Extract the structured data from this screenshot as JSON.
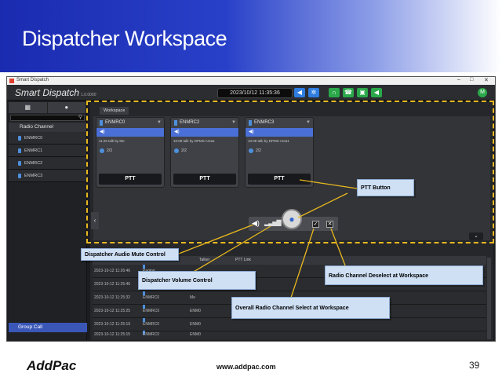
{
  "slide": {
    "title": "Dispatcher Workspace",
    "footer_logo": "AddPac",
    "footer_url": "www.addpac.com",
    "page_number": "39"
  },
  "window": {
    "title": "Smart Dispatch",
    "min": "–",
    "max": "□",
    "close": "✕"
  },
  "app": {
    "brand": "Smart Dispatch",
    "version": "1.0.0000",
    "clock": "2023/10/12 11:35:36",
    "avatar": "M"
  },
  "sidebar": {
    "section": "Radio Channel",
    "channels": [
      "ENMRC0",
      "ENMRC1",
      "ENMRC2",
      "ENMRC3"
    ],
    "group_call": "Group Call"
  },
  "workspace": {
    "tab": "Workspace",
    "cards": [
      {
        "name": "ENMRC0",
        "message": "11:25 talk by Me",
        "count": "2/3",
        "ptt": "PTT"
      },
      {
        "name": "ENMRC2",
        "message": "10:08 talk by DPMS Area1",
        "count": "2/2",
        "ptt": "PTT"
      },
      {
        "name": "ENMRC3",
        "message": "10:08 talk by DPMS Area1",
        "count": "2/2",
        "ptt": "PTT"
      }
    ]
  },
  "log": {
    "headers": [
      "Talker",
      "PTT Link"
    ],
    "rows": [
      {
        "time": "2023-10-12 11:26:46",
        "channel": "Paging",
        "talker": ""
      },
      {
        "time": "2023-10-12 11:25:46",
        "channel": "",
        "talker": ""
      },
      {
        "time": "2023-10-12 11:25:32",
        "channel": "ENMRC0",
        "talker": "Me"
      },
      {
        "time": "2023-10-12 11:25:25",
        "channel": "ENMRC0",
        "talker": "ENM0"
      },
      {
        "time": "2023-10-12 11:25:19",
        "channel": "ENMRC0",
        "talker": "ENM0"
      },
      {
        "time": "2023-10-12 11:25:15",
        "channel": "ENMRC0",
        "talker": "ENM0"
      }
    ]
  },
  "callouts": {
    "ptt_button": "PTT Button",
    "audio_mute": "Dispatcher Audio Mute Control",
    "volume": "Dispatcher Volume Control",
    "deselect": "Radio Channel Deselect at Workspace",
    "select": "Overall Radio Channel Select at Workspace"
  },
  "colors": {
    "accent_blue": "#2f7de1",
    "accent_green": "#2aa84a",
    "highlight_yellow": "#e8b820",
    "callout_bg": "#cfe0f5"
  }
}
